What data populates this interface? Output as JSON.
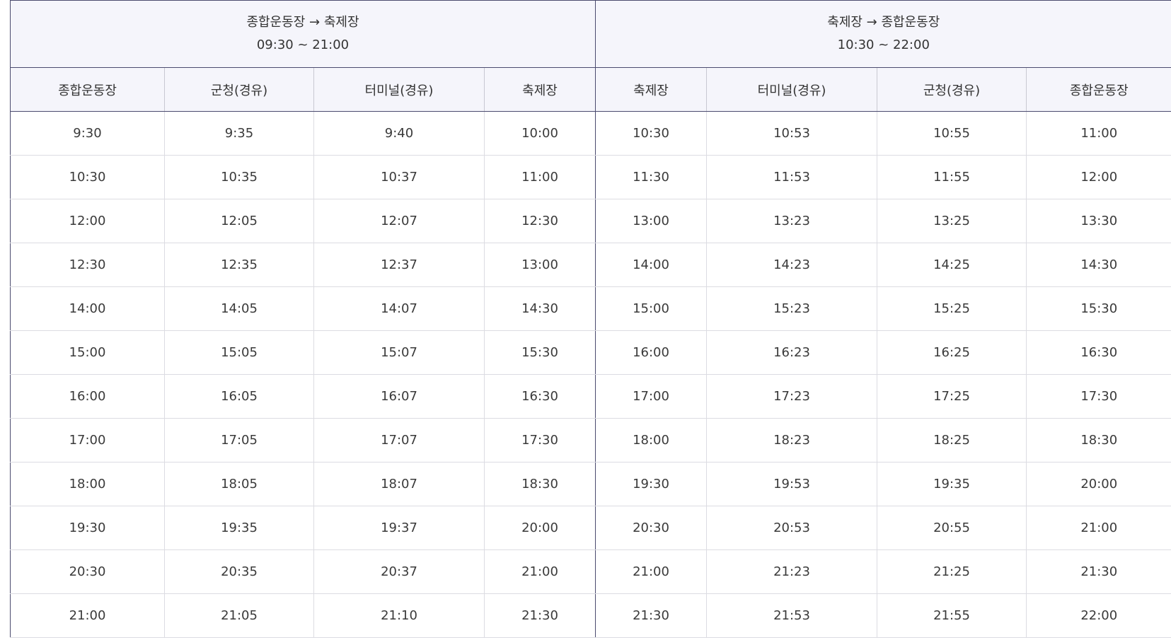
{
  "directions": [
    {
      "title": "종합운동장 → 축제장",
      "range": "09:30 ~ 21:00"
    },
    {
      "title": "축제장 → 종합운동장",
      "range": "10:30 ~ 22:00"
    }
  ],
  "columns": [
    "종합운동장",
    "군청(경유)",
    "터미널(경유)",
    "축제장",
    "축제장",
    "터미널(경유)",
    "군청(경유)",
    "종합운동장"
  ],
  "rows": [
    [
      "9:30",
      "9:35",
      "9:40",
      "10:00",
      "10:30",
      "10:53",
      "10:55",
      "11:00"
    ],
    [
      "10:30",
      "10:35",
      "10:37",
      "11:00",
      "11:30",
      "11:53",
      "11:55",
      "12:00"
    ],
    [
      "12:00",
      "12:05",
      "12:07",
      "12:30",
      "13:00",
      "13:23",
      "13:25",
      "13:30"
    ],
    [
      "12:30",
      "12:35",
      "12:37",
      "13:00",
      "14:00",
      "14:23",
      "14:25",
      "14:30"
    ],
    [
      "14:00",
      "14:05",
      "14:07",
      "14:30",
      "15:00",
      "15:23",
      "15:25",
      "15:30"
    ],
    [
      "15:00",
      "15:05",
      "15:07",
      "15:30",
      "16:00",
      "16:23",
      "16:25",
      "16:30"
    ],
    [
      "16:00",
      "16:05",
      "16:07",
      "16:30",
      "17:00",
      "17:23",
      "17:25",
      "17:30"
    ],
    [
      "17:00",
      "17:05",
      "17:07",
      "17:30",
      "18:00",
      "18:23",
      "18:25",
      "18:30"
    ],
    [
      "18:00",
      "18:05",
      "18:07",
      "18:30",
      "19:30",
      "19:53",
      "19:35",
      "20:00"
    ],
    [
      "19:30",
      "19:35",
      "19:37",
      "20:00",
      "20:30",
      "20:53",
      "20:55",
      "21:00"
    ],
    [
      "20:30",
      "20:35",
      "20:37",
      "21:00",
      "21:00",
      "21:23",
      "21:25",
      "21:30"
    ],
    [
      "21:00",
      "21:05",
      "21:10",
      "21:30",
      "21:30",
      "21:53",
      "21:55",
      "22:00"
    ]
  ]
}
